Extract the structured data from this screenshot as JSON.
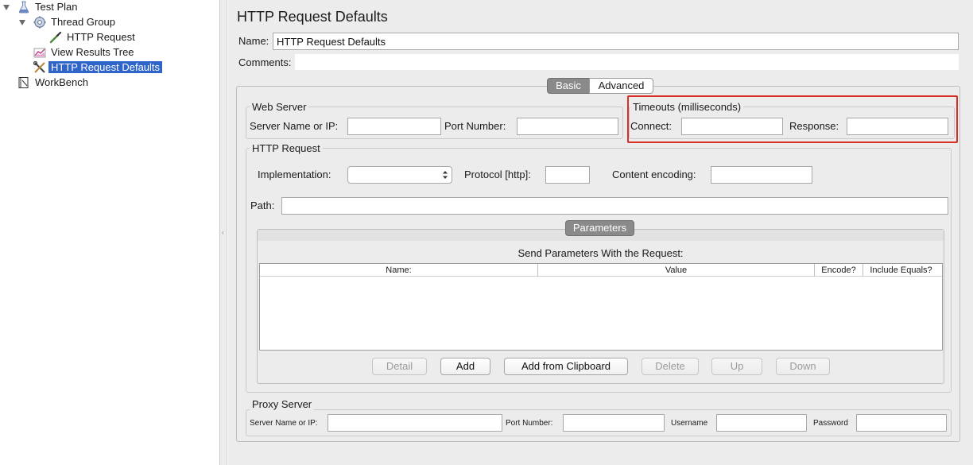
{
  "tree": {
    "items": [
      {
        "label": "Test Plan",
        "icon": "flask-icon"
      },
      {
        "label": "Thread Group",
        "icon": "gear-icon"
      },
      {
        "label": "HTTP Request",
        "icon": "pipette-icon"
      },
      {
        "label": "View Results Tree",
        "icon": "chart-icon"
      },
      {
        "label": "HTTP Request Defaults",
        "icon": "wrench-icon",
        "selected": true
      },
      {
        "label": "WorkBench",
        "icon": "notebook-icon"
      }
    ]
  },
  "panel": {
    "title": "HTTP Request Defaults",
    "name_label": "Name:",
    "name_value": "HTTP Request Defaults",
    "comments_label": "Comments:",
    "tabs": {
      "basic": "Basic",
      "advanced": "Advanced"
    }
  },
  "web_server": {
    "title": "Web Server",
    "server_label": "Server Name or IP:",
    "port_label": "Port Number:",
    "server_value": "",
    "port_value": ""
  },
  "timeouts": {
    "title": "Timeouts (milliseconds)",
    "connect_label": "Connect:",
    "response_label": "Response:",
    "connect_value": "",
    "response_value": "",
    "highlight_color": "#d93025"
  },
  "http_request": {
    "title": "HTTP Request",
    "implementation_label": "Implementation:",
    "implementation_value": "",
    "protocol_label": "Protocol [http]:",
    "protocol_value": "",
    "encoding_label": "Content encoding:",
    "encoding_value": "",
    "path_label": "Path:",
    "path_value": ""
  },
  "parameters": {
    "tab": "Parameters",
    "caption": "Send Parameters With the Request:",
    "columns": [
      "Name:",
      "Value",
      "Encode?",
      "Include Equals?"
    ],
    "buttons": {
      "detail": "Detail",
      "add": "Add",
      "add_clipboard": "Add from Clipboard",
      "delete": "Delete",
      "up": "Up",
      "down": "Down"
    }
  },
  "proxy": {
    "title": "Proxy Server",
    "server_label": "Server Name or IP:",
    "port_label": "Port Number:",
    "username_label": "Username",
    "password_label": "Password",
    "server_value": "",
    "port_value": "",
    "username_value": "",
    "password_value": ""
  },
  "colors": {
    "selection": "#2f65ca",
    "tab_active": "#8a8a8a",
    "panel_bg": "#ececec"
  }
}
